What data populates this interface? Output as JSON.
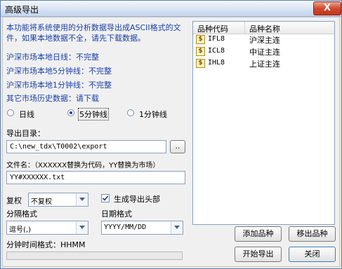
{
  "window": {
    "title": "高级导出",
    "close_glyph": "X"
  },
  "intro": "本功能将系统使用的分析数据导出成ASCII格式的文件，如果本地数据不全，请先下载数据。",
  "status": [
    "沪深市场本地日线：不完整",
    "沪深市场本地5分钟线：不完整",
    "沪深市场本地1分钟线：不完整",
    "其它市场历史数据：请下载"
  ],
  "period": {
    "options": [
      "日线",
      "5分钟线",
      "1分钟线"
    ],
    "selected": "5分钟线"
  },
  "export_dir": {
    "label": "导出目录：",
    "value": "C:\\new_tdx\\T0002\\export",
    "browse_label": ".."
  },
  "filename": {
    "label": "文件名：（XXXXXX替换为代码，YY替换为市场）",
    "value": "YY#XXXXXX.txt"
  },
  "rights": {
    "label": "复权",
    "value": "不复权"
  },
  "header_checkbox": {
    "label": "生成导出头部",
    "checked": true
  },
  "separator": {
    "label": "分隔格式",
    "value": "逗号(,)"
  },
  "date_format": {
    "label": "日期格式",
    "value": "YYYY/MM/DD"
  },
  "minute_time_format": {
    "label": "分钟时间格式：HHMM"
  },
  "list": {
    "columns": [
      "品种代码",
      "品种名称"
    ],
    "rows": [
      {
        "code": "IFL8",
        "name": "沪深主连"
      },
      {
        "code": "ICL8",
        "name": "中证主连"
      },
      {
        "code": "IHL8",
        "name": "上证主连"
      }
    ],
    "icon_glyph": "$"
  },
  "buttons": {
    "add": "添加品种",
    "remove": "移出品种",
    "start": "开始导出",
    "close": "关闭"
  }
}
